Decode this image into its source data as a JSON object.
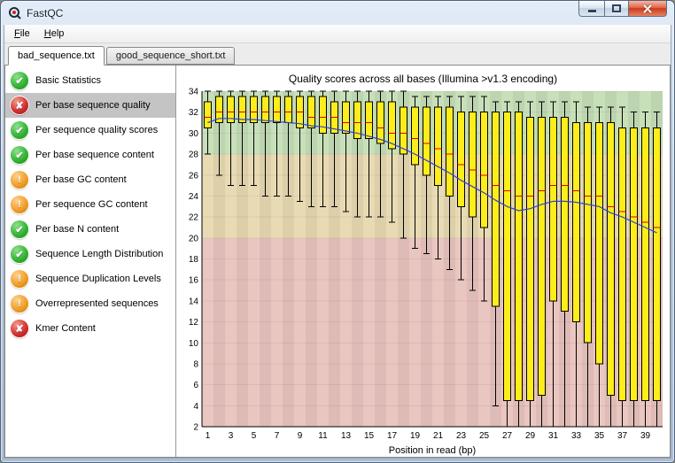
{
  "window": {
    "title": "FastQC",
    "controls": [
      {
        "name": "minimize"
      },
      {
        "name": "maximize"
      },
      {
        "name": "close"
      }
    ]
  },
  "menu": {
    "items": [
      {
        "label": "File"
      },
      {
        "label": "Help"
      }
    ]
  },
  "tabs": [
    {
      "label": "bad_sequence.txt",
      "active": true
    },
    {
      "label": "good_sequence_short.txt",
      "active": false
    }
  ],
  "sidebar": {
    "status_glyphs": {
      "pass": "✔",
      "fail": "✘",
      "warn": "!"
    },
    "status_colors": {
      "pass": "#2eb22e",
      "fail": "#cf2b2b",
      "warn": "#ef9b20"
    },
    "items": [
      {
        "label": "Basic Statistics",
        "status": "pass",
        "selected": false
      },
      {
        "label": "Per base sequence quality",
        "status": "fail",
        "selected": true
      },
      {
        "label": "Per sequence quality scores",
        "status": "pass",
        "selected": false
      },
      {
        "label": "Per base sequence content",
        "status": "pass",
        "selected": false
      },
      {
        "label": "Per base GC content",
        "status": "warn",
        "selected": false
      },
      {
        "label": "Per sequence GC content",
        "status": "warn",
        "selected": false
      },
      {
        "label": "Per base N content",
        "status": "pass",
        "selected": false
      },
      {
        "label": "Sequence Length Distribution",
        "status": "pass",
        "selected": false
      },
      {
        "label": "Sequence Duplication Levels",
        "status": "warn",
        "selected": false
      },
      {
        "label": "Overrepresented sequences",
        "status": "warn",
        "selected": false
      },
      {
        "label": "Kmer Content",
        "status": "fail",
        "selected": false
      }
    ]
  },
  "chart_data": {
    "type": "boxplot",
    "title": "Quality scores across all bases (Illumina >v1.3 encoding)",
    "xlabel": "Position in read (bp)",
    "ylim": [
      2,
      34
    ],
    "y_ticks": [
      2,
      4,
      6,
      8,
      10,
      12,
      14,
      16,
      18,
      20,
      22,
      24,
      26,
      28,
      30,
      32,
      34
    ],
    "x_ticks": [
      1,
      3,
      5,
      7,
      9,
      11,
      13,
      15,
      17,
      19,
      21,
      23,
      25,
      27,
      29,
      31,
      33,
      35,
      37,
      39
    ],
    "zones": [
      {
        "from": 28,
        "to": 34,
        "color": "#c8e0ba"
      },
      {
        "from": 20,
        "to": 28,
        "color": "#e8dbb4"
      },
      {
        "from": 2,
        "to": 20,
        "color": "#eac6c0"
      }
    ],
    "box_fill": "#fced1b",
    "median_color": "#e00000",
    "mean_color": "#3344cc",
    "boxes": [
      {
        "pos": 1,
        "low": 28,
        "q1": 30.5,
        "med": 31.5,
        "q3": 33,
        "high": 34,
        "mean": 31.0
      },
      {
        "pos": 2,
        "low": 26,
        "q1": 31,
        "med": 32,
        "q3": 33.5,
        "high": 34,
        "mean": 31.4
      },
      {
        "pos": 3,
        "low": 25,
        "q1": 31,
        "med": 32,
        "q3": 33.5,
        "high": 34,
        "mean": 31.4
      },
      {
        "pos": 4,
        "low": 25,
        "q1": 31,
        "med": 32,
        "q3": 33.5,
        "high": 34,
        "mean": 31.3
      },
      {
        "pos": 5,
        "low": 25,
        "q1": 31,
        "med": 32,
        "q3": 33.5,
        "high": 34,
        "mean": 31.3
      },
      {
        "pos": 6,
        "low": 24,
        "q1": 31,
        "med": 32,
        "q3": 33.5,
        "high": 34,
        "mean": 31.2
      },
      {
        "pos": 7,
        "low": 24,
        "q1": 31,
        "med": 32,
        "q3": 33.5,
        "high": 34,
        "mean": 31.1
      },
      {
        "pos": 8,
        "low": 24,
        "q1": 31,
        "med": 32,
        "q3": 33.5,
        "high": 34,
        "mean": 31.0
      },
      {
        "pos": 9,
        "low": 23.5,
        "q1": 30.5,
        "med": 32,
        "q3": 33.5,
        "high": 34,
        "mean": 30.9
      },
      {
        "pos": 10,
        "low": 23,
        "q1": 30.5,
        "med": 31.5,
        "q3": 33.5,
        "high": 34,
        "mean": 30.7
      },
      {
        "pos": 11,
        "low": 23,
        "q1": 30,
        "med": 31.5,
        "q3": 33.5,
        "high": 34,
        "mean": 30.6
      },
      {
        "pos": 12,
        "low": 23,
        "q1": 30,
        "med": 31.5,
        "q3": 33,
        "high": 34,
        "mean": 30.4
      },
      {
        "pos": 13,
        "low": 22.5,
        "q1": 30,
        "med": 31,
        "q3": 33,
        "high": 34,
        "mean": 30.2
      },
      {
        "pos": 14,
        "low": 22,
        "q1": 29.5,
        "med": 31,
        "q3": 33,
        "high": 34,
        "mean": 30.0
      },
      {
        "pos": 15,
        "low": 22,
        "q1": 29.5,
        "med": 31,
        "q3": 33,
        "high": 34,
        "mean": 29.7
      },
      {
        "pos": 16,
        "low": 22,
        "q1": 29,
        "med": 30.5,
        "q3": 33,
        "high": 34,
        "mean": 29.4
      },
      {
        "pos": 17,
        "low": 21.5,
        "q1": 28.5,
        "med": 30,
        "q3": 33,
        "high": 34,
        "mean": 29.0
      },
      {
        "pos": 18,
        "low": 20,
        "q1": 28,
        "med": 30,
        "q3": 32.5,
        "high": 34,
        "mean": 28.5
      },
      {
        "pos": 19,
        "low": 19,
        "q1": 27,
        "med": 29.5,
        "q3": 32.5,
        "high": 33.5,
        "mean": 28.0
      },
      {
        "pos": 20,
        "low": 18.5,
        "q1": 26,
        "med": 29,
        "q3": 32.5,
        "high": 33.5,
        "mean": 27.4
      },
      {
        "pos": 21,
        "low": 18,
        "q1": 25,
        "med": 28.5,
        "q3": 32.5,
        "high": 33.5,
        "mean": 26.8
      },
      {
        "pos": 22,
        "low": 17,
        "q1": 24,
        "med": 28,
        "q3": 32.5,
        "high": 33.5,
        "mean": 26.2
      },
      {
        "pos": 23,
        "low": 16,
        "q1": 23,
        "med": 27,
        "q3": 32,
        "high": 33.5,
        "mean": 25.5
      },
      {
        "pos": 24,
        "low": 15,
        "q1": 22,
        "med": 26.5,
        "q3": 32,
        "high": 33.5,
        "mean": 24.9
      },
      {
        "pos": 25,
        "low": 14,
        "q1": 21,
        "med": 26,
        "q3": 32,
        "high": 33.5,
        "mean": 24.3
      },
      {
        "pos": 26,
        "low": 4,
        "q1": 13.5,
        "med": 25,
        "q3": 32,
        "high": 33,
        "mean": 23.6
      },
      {
        "pos": 27,
        "low": 2,
        "q1": 4.5,
        "med": 24.5,
        "q3": 32,
        "high": 33,
        "mean": 23.0
      },
      {
        "pos": 28,
        "low": 2,
        "q1": 4.5,
        "med": 24,
        "q3": 32,
        "high": 33,
        "mean": 22.6
      },
      {
        "pos": 29,
        "low": 2,
        "q1": 4.5,
        "med": 24,
        "q3": 31.5,
        "high": 33,
        "mean": 22.8
      },
      {
        "pos": 30,
        "low": 2,
        "q1": 5,
        "med": 24.5,
        "q3": 31.5,
        "high": 33,
        "mean": 23.2
      },
      {
        "pos": 31,
        "low": 2,
        "q1": 14,
        "med": 25,
        "q3": 31.5,
        "high": 33,
        "mean": 23.5
      },
      {
        "pos": 32,
        "low": 2,
        "q1": 13,
        "med": 25,
        "q3": 31.5,
        "high": 33,
        "mean": 23.5
      },
      {
        "pos": 33,
        "low": 2,
        "q1": 12,
        "med": 24.5,
        "q3": 31,
        "high": 33,
        "mean": 23.4
      },
      {
        "pos": 34,
        "low": 2,
        "q1": 10,
        "med": 24,
        "q3": 31,
        "high": 32.5,
        "mean": 23.2
      },
      {
        "pos": 35,
        "low": 2,
        "q1": 8,
        "med": 24,
        "q3": 31,
        "high": 32.5,
        "mean": 23.0
      },
      {
        "pos": 36,
        "low": 2,
        "q1": 5,
        "med": 23,
        "q3": 31,
        "high": 32.5,
        "mean": 22.4
      },
      {
        "pos": 37,
        "low": 2,
        "q1": 4.5,
        "med": 22.5,
        "q3": 30.5,
        "high": 32.5,
        "mean": 22.0
      },
      {
        "pos": 38,
        "low": 2,
        "q1": 4.5,
        "med": 22,
        "q3": 30.5,
        "high": 32,
        "mean": 21.5
      },
      {
        "pos": 39,
        "low": 2,
        "q1": 4.5,
        "med": 21.5,
        "q3": 30.5,
        "high": 32,
        "mean": 21.0
      },
      {
        "pos": 40,
        "low": 2,
        "q1": 4.5,
        "med": 21,
        "q3": 30.5,
        "high": 32,
        "mean": 20.5
      }
    ]
  }
}
